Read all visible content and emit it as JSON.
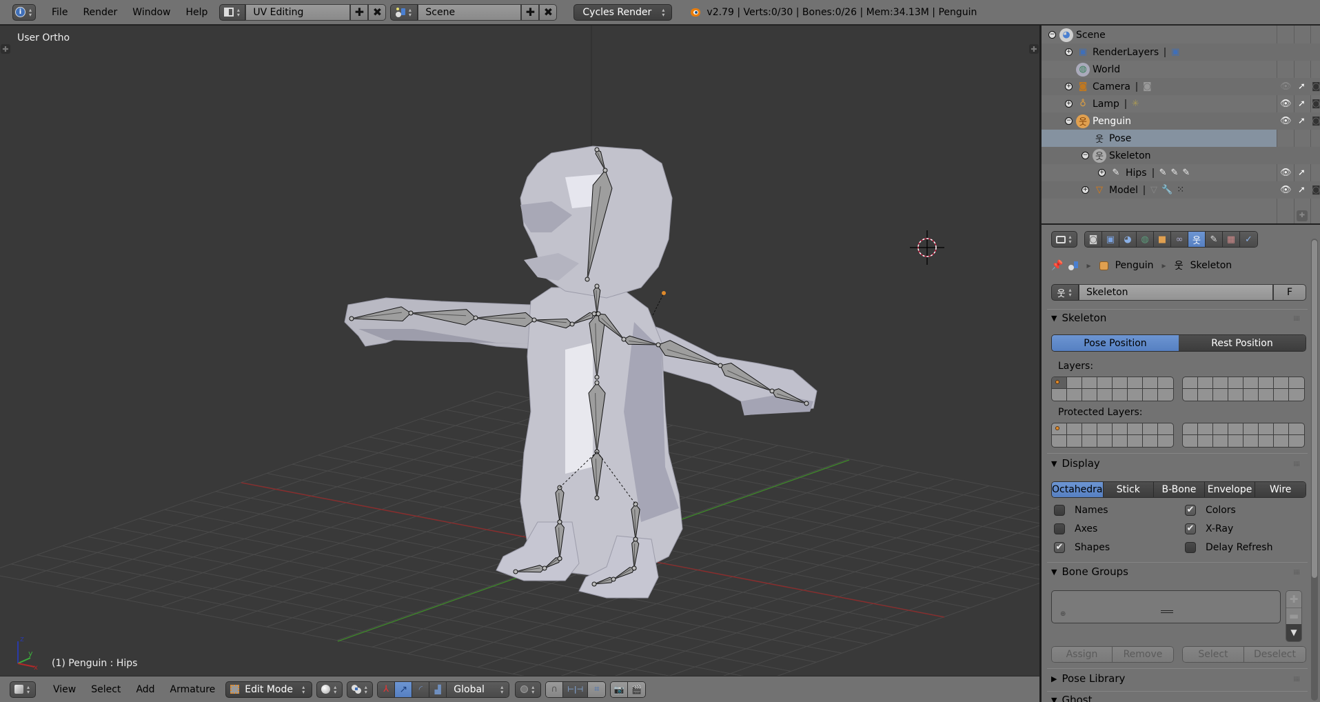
{
  "topbar": {
    "menus": [
      "File",
      "Render",
      "Window",
      "Help"
    ],
    "screen_layout": "UV Editing",
    "scene": "Scene",
    "render_engine": "Cycles Render",
    "stats": "v2.79 | Verts:0/30 | Bones:0/26 | Mem:34.13M | Penguin",
    "icons": {
      "info": "info-icon",
      "layout": "screen-layout-icon",
      "scene": "scene-icon",
      "add": "plus-icon",
      "remove": "x-icon",
      "blender": "blender-logo-icon"
    }
  },
  "viewport": {
    "view_label": "User Ortho",
    "object_label": "(1) Penguin : Hips",
    "axes": {
      "x": "x",
      "y": "y",
      "z": "z"
    },
    "colors": {
      "background": "#393939",
      "grid": "#4a4a4a",
      "x_axis": "#8e2a2a",
      "y_axis": "#3f8a2a",
      "mesh": "#c8c8d2",
      "cursor": "#c02040"
    }
  },
  "view3d_header": {
    "menus": [
      "View",
      "Select",
      "Add",
      "Armature"
    ],
    "mode": "Edit Mode",
    "orientation": "Global",
    "icons": [
      "editor-type-3dview-icon",
      "viewport-shading-solid-icon",
      "pivot-point-icon",
      "manipulator-toggle-icon",
      "translate-icon",
      "rotate-icon",
      "scale-icon",
      "proportional-edit-icon",
      "snap-magnet-icon",
      "snap-element-icon",
      "snap-target-icon",
      "opengl-render-icon",
      "opengl-animation-icon"
    ]
  },
  "outliner": {
    "rows": [
      {
        "name": "Scene",
        "icon": "scene-icon",
        "expanded": true,
        "extra_icons": []
      },
      {
        "name": "RenderLayers",
        "icon": "render-layers-icon",
        "expanded": false,
        "extra_icons": [
          "render-layer-icon"
        ]
      },
      {
        "name": "World",
        "icon": "world-icon",
        "expanded": null,
        "extra_icons": []
      },
      {
        "name": "Camera",
        "icon": "camera-object-icon",
        "expanded": false,
        "extra_icons": [
          "camera-data-icon"
        ],
        "visible": false,
        "selectable": true,
        "renderable": true
      },
      {
        "name": "Lamp",
        "icon": "lamp-object-icon",
        "expanded": false,
        "extra_icons": [
          "lamp-data-icon"
        ],
        "visible": true,
        "selectable": true,
        "renderable": true
      },
      {
        "name": "Penguin",
        "icon": "armature-object-icon",
        "expanded": true,
        "active": true,
        "extra_icons": [],
        "visible": true,
        "selectable": true,
        "renderable": true
      },
      {
        "name": "Pose",
        "icon": "pose-icon",
        "expanded": null,
        "selected": true,
        "extra_icons": []
      },
      {
        "name": "Skeleton",
        "icon": "armature-data-icon",
        "expanded": true,
        "extra_icons": []
      },
      {
        "name": "Hips",
        "icon": "bone-icon",
        "expanded": false,
        "extra_icons": [
          "bone-icon",
          "bone-icon",
          "bone-icon"
        ],
        "visible": true,
        "selectable": true
      },
      {
        "name": "Model",
        "icon": "mesh-object-icon",
        "expanded": false,
        "extra_icons": [
          "mesh-data-icon",
          "modifier-wrench-icon",
          "vertex-groups-icon"
        ],
        "visible": true,
        "selectable": true,
        "renderable": true
      }
    ]
  },
  "properties": {
    "tabs": [
      "render",
      "render-layers",
      "scene",
      "world",
      "object",
      "constraints",
      "armature-data",
      "bone",
      "material",
      "bone-constraints"
    ],
    "active_tab": "armature-data",
    "breadcrumb": [
      "Penguin",
      "Skeleton"
    ],
    "datablock_name": "Skeleton",
    "fake_user_label": "F",
    "skeleton_panel": {
      "title": "Skeleton",
      "pose_position": "Pose Position",
      "rest_position": "Rest Position",
      "active_position": "Pose Position",
      "layers_label": "Layers:",
      "protected_layers_label": "Protected Layers:"
    },
    "display_panel": {
      "title": "Display",
      "draw_types": [
        "Octahedra",
        "Stick",
        "B-Bone",
        "Envelope",
        "Wire"
      ],
      "active_draw_type": "Octahedra",
      "options": [
        {
          "label": "Names",
          "checked": false
        },
        {
          "label": "Colors",
          "checked": true
        },
        {
          "label": "Axes",
          "checked": false
        },
        {
          "label": "X-Ray",
          "checked": true
        },
        {
          "label": "Shapes",
          "checked": true
        },
        {
          "label": "Delay Refresh",
          "checked": false
        }
      ]
    },
    "bone_groups_panel": {
      "title": "Bone Groups",
      "buttons": [
        "Assign",
        "Remove",
        "Select",
        "Deselect"
      ]
    },
    "pose_library_panel": {
      "title": "Pose Library"
    },
    "ghost_panel": {
      "title": "Ghost"
    }
  }
}
